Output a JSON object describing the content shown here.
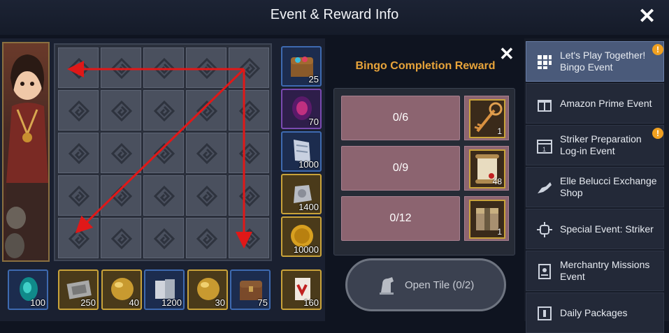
{
  "header": {
    "title": "Event & Reward Info"
  },
  "board": {
    "tiles": 25,
    "side_items": [
      {
        "qty": "25",
        "icon": "treasure-chest-icon",
        "grade": "blue"
      },
      {
        "qty": "70",
        "icon": "purple-gem-icon",
        "grade": "purple"
      },
      {
        "qty": "1000",
        "icon": "silver-scroll-icon",
        "grade": "blue"
      },
      {
        "qty": "1400",
        "icon": "ore-bundle-icon",
        "grade": "gold"
      },
      {
        "qty": "10000",
        "icon": "gold-coin-icon",
        "grade": "gold"
      }
    ],
    "bottom_items": [
      {
        "qty": "100",
        "icon": "teal-gem-icon",
        "grade": "blue"
      },
      {
        "qty": "250",
        "icon": "engraved-tablet-icon",
        "grade": "gold"
      },
      {
        "qty": "40",
        "icon": "golden-orb-icon",
        "grade": "gold"
      },
      {
        "qty": "1200",
        "icon": "metal-ingot-icon",
        "grade": "blue"
      },
      {
        "qty": "30",
        "icon": "golden-orb-icon",
        "grade": "gold"
      },
      {
        "qty": "75",
        "icon": "wooden-chest-icon",
        "grade": "blue"
      },
      {
        "qty": "160",
        "icon": "red-banner-scroll-icon",
        "grade": "gold"
      }
    ]
  },
  "reward": {
    "title": "Bingo Completion Reward",
    "rows": [
      {
        "progress": "0/6",
        "qty": "1",
        "icon": "ornate-key-icon"
      },
      {
        "progress": "0/9",
        "qty": "48",
        "icon": "scroll-icon"
      },
      {
        "progress": "0/12",
        "qty": "1",
        "icon": "ornate-box-icon"
      }
    ],
    "open_tile_label": "Open Tile (0/2)"
  },
  "sidebar": {
    "items": [
      {
        "label": "Let's Play Together! Bingo Event",
        "icon": "bingo-grid-icon",
        "badge": "!"
      },
      {
        "label": "Amazon Prime Event",
        "icon": "gift-icon",
        "badge": ""
      },
      {
        "label": "Striker Preparation Log-in Event",
        "icon": "calendar-icon",
        "badge": "!"
      },
      {
        "label": "Elle Belucci Exchange Shop",
        "icon": "handshake-icon",
        "badge": ""
      },
      {
        "label": "Special Event: Striker",
        "icon": "special-event-icon",
        "badge": ""
      },
      {
        "label": "Merchantry Missions Event",
        "icon": "mission-book-icon",
        "badge": ""
      },
      {
        "label": "Daily Packages",
        "icon": "package-icon",
        "badge": ""
      }
    ]
  },
  "colors": {
    "accent": "#e8a43a",
    "arrow": "#e01818",
    "badge": "#f0a020"
  }
}
